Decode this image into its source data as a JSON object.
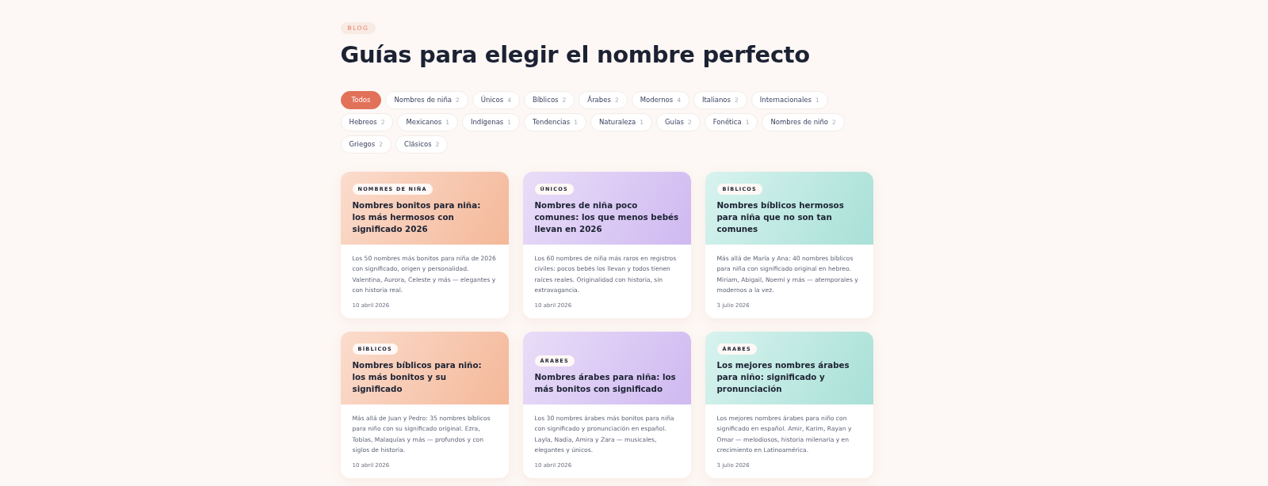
{
  "eyebrow": "BLOG",
  "title": "Guías para elegir el nombre perfecto",
  "filters": [
    {
      "label": "Todos",
      "selected": true
    },
    {
      "label": "Nombres de niña",
      "count": "2",
      "selected": false
    },
    {
      "label": "Únicos",
      "count": "4",
      "selected": false
    },
    {
      "label": "Bíblicos",
      "count": "2",
      "selected": false
    },
    {
      "label": "Árabes",
      "count": "2",
      "selected": false
    },
    {
      "label": "Modernos",
      "count": "4",
      "selected": false
    },
    {
      "label": "Italianos",
      "count": "2",
      "selected": false
    },
    {
      "label": "Internacionales",
      "count": "1",
      "selected": false
    },
    {
      "label": "Hebreos",
      "count": "2",
      "selected": false
    },
    {
      "label": "Mexicanos",
      "count": "1",
      "selected": false
    },
    {
      "label": "Indígenas",
      "count": "1",
      "selected": false
    },
    {
      "label": "Tendencias",
      "count": "1",
      "selected": false
    },
    {
      "label": "Naturaleza",
      "count": "1",
      "selected": false
    },
    {
      "label": "Guías",
      "count": "2",
      "selected": false
    },
    {
      "label": "Fonética",
      "count": "1",
      "selected": false
    },
    {
      "label": "Nombres de niño",
      "count": "2",
      "selected": false
    },
    {
      "label": "Griegos",
      "count": "2",
      "selected": false
    },
    {
      "label": "Clásicos",
      "count": "2",
      "selected": false
    }
  ],
  "posts": [
    {
      "kind": "peach",
      "tag": "NOMBRES DE NIÑA",
      "title": "Nombres bonitos para niña: los más hermosos con significado 2026",
      "excerpt": "Los 50 nombres más bonitos para niña de 2026 con significado, origen y personalidad. Valentina, Aurora, Celeste y más — elegantes y con historia real.",
      "date": "10 abril 2026"
    },
    {
      "kind": "lilac",
      "tag": "ÚNICOS",
      "title": "Nombres de niña poco comunes: los que menos bebés llevan en 2026",
      "excerpt": "Los 60 nombres de niña más raros en registros civiles: pocos bebés los llevan y todos tienen raíces reales. Originalidad con historia, sin extravagancia.",
      "date": "10 abril 2026"
    },
    {
      "kind": "mint",
      "tag": "BÍBLICOS",
      "title": "Nombres bíblicos hermosos para niña que no son tan comunes",
      "excerpt": "Más allá de María y Ana: 40 nombres bíblicos para niña con significado original en hebreo. Miriam, Abigail, Noemí y más — atemporales y modernos a la vez.",
      "date": "3 julio 2026"
    },
    {
      "kind": "peach",
      "tag": "BÍBLICOS",
      "title": "Nombres bíblicos para niño: los más bonitos y su significado",
      "excerpt": "Más allá de Juan y Pedro: 35 nombres bíblicos para niño con su significado original. Ezra, Tobías, Malaquías y más — profundos y con siglos de historia.",
      "date": "10 abril 2026"
    },
    {
      "kind": "lilac",
      "tag": "ÁRABES",
      "title": "Nombres árabes para niña: los más bonitos con significado",
      "excerpt": "Los 30 nombres árabes más bonitos para niña con significado y pronunciación en español. Layla, Nadia, Amira y Zara — musicales, elegantes y únicos.",
      "date": "10 abril 2026"
    },
    {
      "kind": "mint",
      "tag": "ÁRABES",
      "title": "Los mejores nombres árabes para niño: significado y pronunciación",
      "excerpt": "Los mejores nombres árabes para niño con significado en español. Amir, Karim, Rayan y Omar — melodiosos, historia milenaria y en crecimiento en Latinoamérica.",
      "date": "3 julio 2026"
    }
  ]
}
